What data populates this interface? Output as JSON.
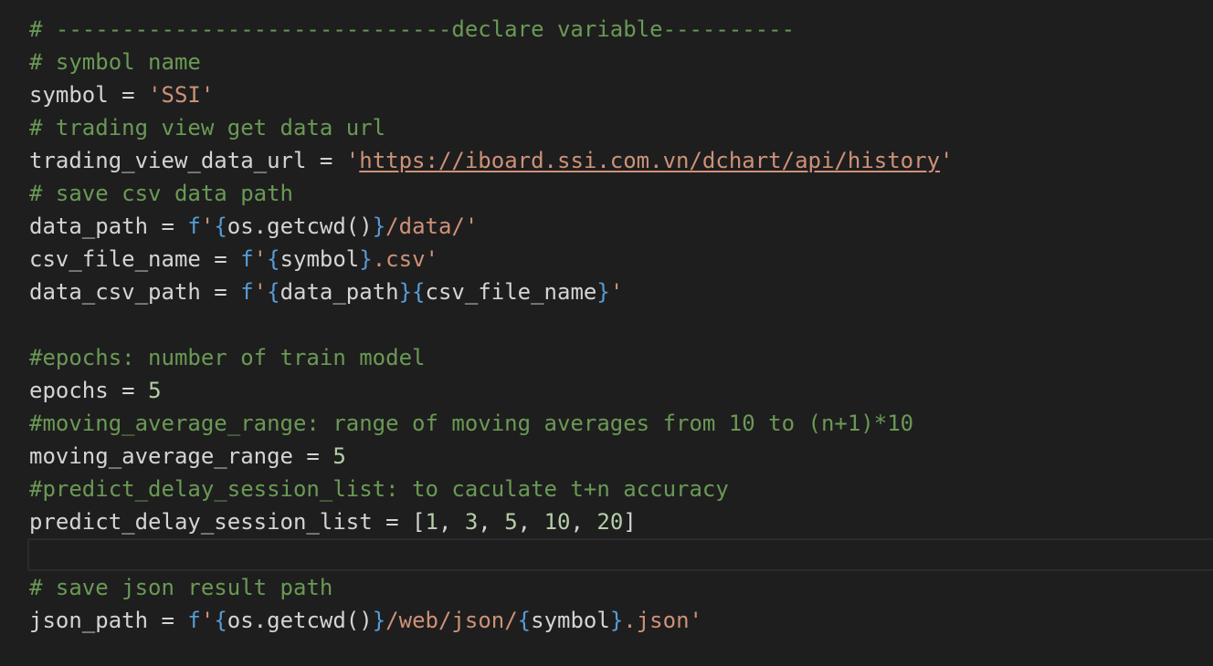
{
  "editor": {
    "lines": [
      "# ------------------------------declare variable----------",
      "# symbol name",
      "symbol = 'SSI'",
      "# trading view get data url",
      "trading_view_data_url = 'https://iboard.ssi.com.vn/dchart/api/history'",
      "# save csv data path",
      "data_path = f'{os.getcwd()}/data/'",
      "csv_file_name = f'{symbol}.csv'",
      "data_csv_path = f'{data_path}{csv_file_name}'",
      "",
      "#epochs: number of train model",
      "epochs = 5",
      "#moving_average_range: range of moving averages from 10 to (n+1)*10",
      "moving_average_range = 5",
      "#predict_delay_session_list: to caculate t+n accuracy",
      "predict_delay_session_list = [1, 3, 5, 10, 20]",
      "",
      "# save json result path",
      "json_path = f'{os.getcwd()}/web/json/{symbol}.json'"
    ],
    "tokens": {
      "comment_declare": "# ------------------------------declare variable----------",
      "comment_symbol": "# symbol name",
      "symbol_name": "symbol",
      "symbol_value": "'SSI'",
      "comment_url": "# trading view get data url",
      "url_var": "trading_view_data_url",
      "url_value": "https://iboard.ssi.com.vn/dchart/api/history",
      "comment_csv": "# save csv data path",
      "data_path_var": "data_path",
      "csv_file_name_var": "csv_file_name",
      "data_csv_path_var": "data_csv_path",
      "comment_epochs": "#epochs: number of train model",
      "epochs_var": "epochs",
      "epochs_value": "5",
      "comment_ma": "#moving_average_range: range of moving averages from 10 to (n+1)*10",
      "ma_var": "moving_average_range",
      "ma_value": "5",
      "comment_predict": "#predict_delay_session_list: to caculate t+n accuracy",
      "predict_var": "predict_delay_session_list",
      "predict_values": [
        "1",
        "3",
        "5",
        "10",
        "20"
      ],
      "comment_json": "# save json result path",
      "json_var": "json_path"
    }
  },
  "colors": {
    "background": "#1e1e1e",
    "comment": "#6a9955",
    "string": "#ce9178",
    "keyword": "#569cd6",
    "number": "#b5cea8",
    "text": "#d4d4d4"
  }
}
